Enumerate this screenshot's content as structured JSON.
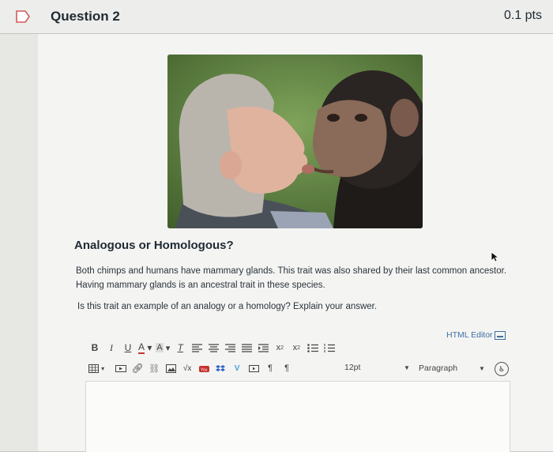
{
  "question": {
    "title": "Question 2",
    "points": "0.1 pts",
    "heading": "Analogous or Homologous?",
    "paragraph": "Both chimps and humans have mammary glands. This trait was also shared by their last common ancestor. Having mammary glands is an ancestral trait in these species.",
    "prompt": "Is this trait an example of an analogy or a homology? Explain your answer."
  },
  "editor": {
    "html_editor_label": "HTML Editor",
    "font_size": "12pt",
    "block_format": "Paragraph"
  },
  "toolbar": {
    "row1": [
      "bold-icon",
      "italic-icon",
      "underline-icon",
      "text-color-icon",
      "background-color-icon",
      "clear-formatting-icon",
      "align-left-icon",
      "align-center-icon",
      "align-right-icon",
      "align-justify-icon",
      "indent-icon",
      "superscript-icon",
      "subscript-icon",
      "bullet-list-icon",
      "numbered-list-icon"
    ],
    "row2": [
      "table-icon",
      "media-icon",
      "link-icon",
      "unlink-icon",
      "image-icon",
      "equation-icon",
      "youtube-icon",
      "dropbox-icon",
      "vimeo-icon",
      "embed-icon",
      "ltr-icon",
      "rtl-icon"
    ]
  },
  "colors": {
    "link": "#3d6fa4",
    "heading": "#1f2a33",
    "background": "#f4f4f2"
  }
}
